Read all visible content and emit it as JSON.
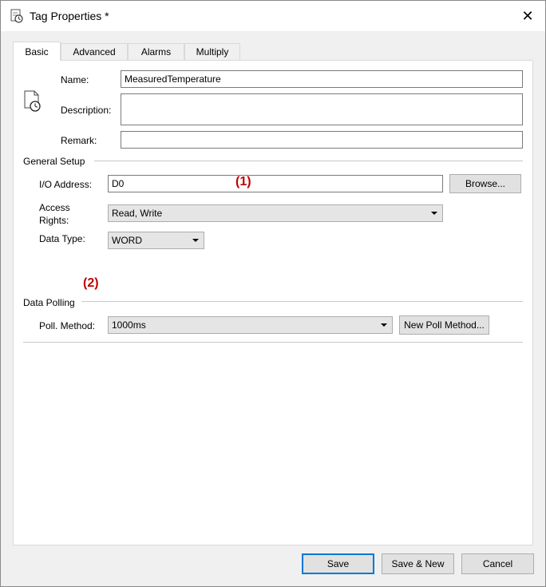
{
  "window": {
    "title": "Tag Properties *",
    "close_label": "✕"
  },
  "tabs": [
    {
      "label": "Basic",
      "active": true
    },
    {
      "label": "Advanced",
      "active": false
    },
    {
      "label": "Alarms",
      "active": false
    },
    {
      "label": "Multiply",
      "active": false
    }
  ],
  "basic": {
    "name_label": "Name:",
    "name_value": "MeasuredTemperature",
    "description_label": "Description:",
    "description_value": "",
    "remark_label": "Remark:",
    "remark_value": ""
  },
  "general_setup": {
    "heading": "General Setup",
    "io_address_label": "I/O Address:",
    "io_address_value": "D0",
    "browse_label": "Browse...",
    "access_rights_label_line1": "Access",
    "access_rights_label_line2": "Rights:",
    "access_rights_value": "Read, Write",
    "data_type_label": "Data Type:",
    "data_type_value": "WORD"
  },
  "data_polling": {
    "heading": "Data Polling",
    "poll_method_label": "Poll. Method:",
    "poll_method_value": "1000ms",
    "new_poll_method_label": "New Poll Method..."
  },
  "annotations": {
    "marker_1": "(1)",
    "marker_2": "(2)",
    "color": "#c00000"
  },
  "footer": {
    "save_label": "Save",
    "save_new_label": "Save & New",
    "cancel_label": "Cancel"
  },
  "colors": {
    "accent": "#0078d7",
    "marker": "#c00000"
  }
}
